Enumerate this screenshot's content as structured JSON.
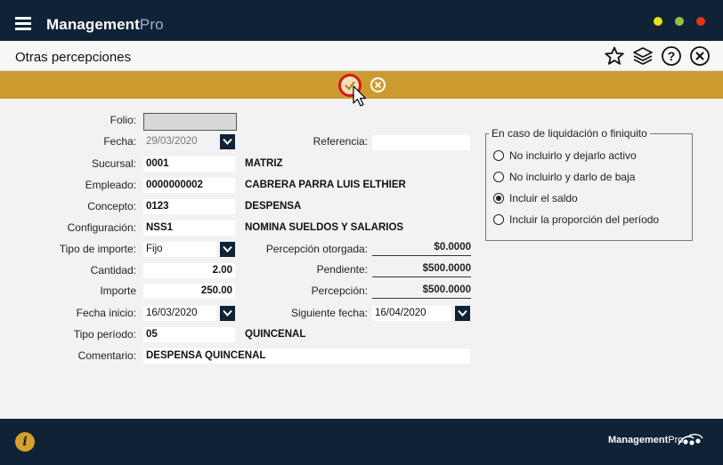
{
  "app": {
    "brand_main": "Management",
    "brand_pro": "Pro",
    "window_dots": {
      "yellow": "#e8e01a",
      "green": "#8cc63f",
      "red": "#e0341f"
    }
  },
  "titlebar": {
    "title": "Otras percepciones",
    "icons": [
      "star-icon",
      "layers-icon",
      "help-icon",
      "close-icon"
    ]
  },
  "actionbar": {
    "color": "#cc9b2f",
    "accept_icon": "check-icon",
    "cancel_icon": "cancel-icon"
  },
  "form": {
    "folio": {
      "label": "Folio:",
      "value": ""
    },
    "fecha": {
      "label": "Fecha:",
      "value": "29/03/2020"
    },
    "referencia": {
      "label": "Referencia:",
      "value": ""
    },
    "sucursal": {
      "label": "Sucursal:",
      "value": "0001",
      "desc": "MATRIZ"
    },
    "empleado": {
      "label": "Empleado:",
      "value": "0000000002",
      "desc": "CABRERA PARRA LUIS ELTHIER"
    },
    "concepto": {
      "label": "Concepto:",
      "value": "0123",
      "desc": "DESPENSA"
    },
    "configuracion": {
      "label": "Configuración:",
      "value": "NSS1",
      "desc": "NOMINA SUELDOS Y SALARIOS"
    },
    "tipo_importe": {
      "label": "Tipo de importe:",
      "value": "Fijo"
    },
    "percepcion_otorgada": {
      "label": "Percepción otorgada:",
      "value": "$0.0000"
    },
    "cantidad": {
      "label": "Cantidad:",
      "value": "2.00"
    },
    "pendiente": {
      "label": "Pendiente:",
      "value": "$500.0000"
    },
    "importe": {
      "label": "Importe",
      "value": "250.00"
    },
    "percepcion": {
      "label": "Percepción:",
      "value": "$500.0000"
    },
    "fecha_inicio": {
      "label": "Fecha inicio:",
      "value": "16/03/2020"
    },
    "siguiente_fecha": {
      "label": "Siguiente fecha:",
      "value": "16/04/2020"
    },
    "tipo_periodo": {
      "label": "Tipo período:",
      "value": "05",
      "desc": "QUINCENAL"
    },
    "comentario": {
      "label": "Comentario:",
      "value": "DESPENSA QUINCENAL"
    }
  },
  "liquidacion": {
    "legend": "En caso de liquidación o finiquito",
    "options": [
      {
        "label": "No incluirlo y dejarlo activo",
        "selected": false
      },
      {
        "label": "No incluirlo y darlo de baja",
        "selected": false
      },
      {
        "label": "Incluir el saldo",
        "selected": true
      },
      {
        "label": "Incluir la proporción del período",
        "selected": false
      }
    ]
  },
  "footer": {
    "info_icon": "info-icon",
    "brand_main": "Management",
    "brand_pro": "Pro"
  }
}
